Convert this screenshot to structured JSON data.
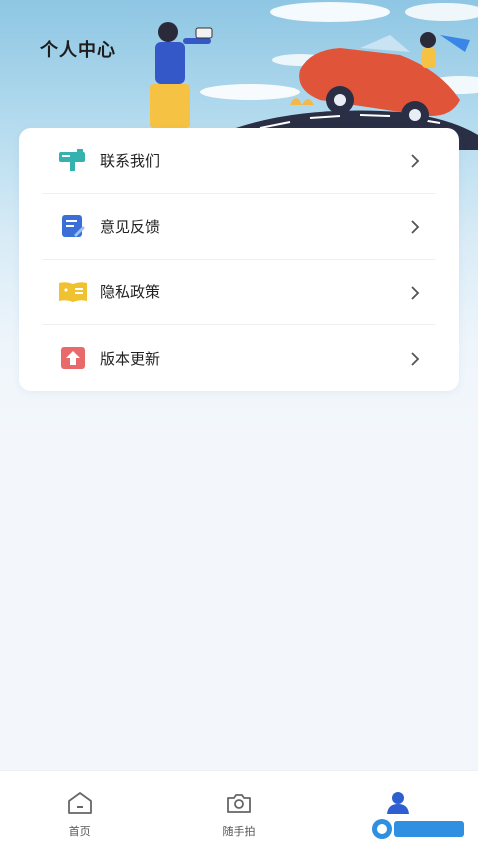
{
  "header": {
    "title": "个人中心"
  },
  "menu": {
    "items": [
      {
        "label": "联系我们",
        "icon": "mailbox-icon",
        "color": "#33b2b0"
      },
      {
        "label": "意见反馈",
        "icon": "feedback-edit-icon",
        "color": "#3a6fd8"
      },
      {
        "label": "隐私政策",
        "icon": "privacy-book-icon",
        "color": "#f0c230"
      },
      {
        "label": "版本更新",
        "icon": "upload-arrow-icon",
        "color": "#e86a6a"
      }
    ]
  },
  "tabbar": {
    "tabs": [
      {
        "label": "首页",
        "icon": "home-icon",
        "active": false
      },
      {
        "label": "随手拍",
        "icon": "camera-icon",
        "active": false
      },
      {
        "label": "",
        "icon": "user-icon",
        "active": true
      }
    ]
  },
  "colors": {
    "accent": "#2d5fd0",
    "background": "#f3f7fb"
  }
}
